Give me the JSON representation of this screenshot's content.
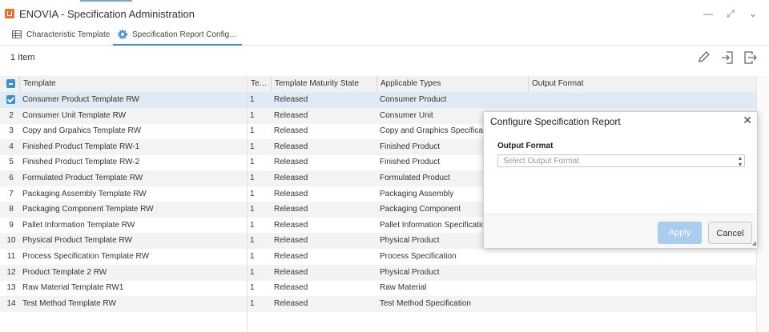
{
  "window": {
    "title": "ENOVIA - Specification Administration",
    "controls": {
      "minimize": "—",
      "expand": "⤢",
      "menu": "⌄"
    }
  },
  "tabs": [
    {
      "label": "Characteristic Template",
      "icon": "table-icon",
      "active": false
    },
    {
      "label": "Specification Report Config…",
      "icon": "gear-icon",
      "active": true
    }
  ],
  "toolbar": {
    "item_count": "1 Item",
    "icons": [
      "edit-icon",
      "import-icon",
      "export-icon"
    ]
  },
  "table": {
    "columns": [
      "Template",
      "Te…",
      "Template Maturity State",
      "Applicable Types",
      "Output Format"
    ],
    "rows": [
      {
        "num": "",
        "template": "Consumer Product Template RW",
        "rev": "1",
        "state": "Released",
        "type": "Consumer Product",
        "output": "",
        "selected": true
      },
      {
        "num": "2",
        "template": "Consumer Unit Template RW",
        "rev": "1",
        "state": "Released",
        "type": "Consumer Unit",
        "output": ""
      },
      {
        "num": "3",
        "template": "Copy and Grpahics Template RW",
        "rev": "1",
        "state": "Released",
        "type": "Copy and Graphics Specification",
        "output": ""
      },
      {
        "num": "4",
        "template": "Finished Product Template RW-1",
        "rev": "1",
        "state": "Released",
        "type": "Finished Product",
        "output": ""
      },
      {
        "num": "5",
        "template": "Finished Product Template RW-2",
        "rev": "1",
        "state": "Released",
        "type": "Finished Product",
        "output": ""
      },
      {
        "num": "6",
        "template": "Formulated Product Template RW",
        "rev": "1",
        "state": "Released",
        "type": "Formulated Product",
        "output": ""
      },
      {
        "num": "7",
        "template": "Packaging Assembly Template RW",
        "rev": "1",
        "state": "Released",
        "type": "Packaging Assembly",
        "output": ""
      },
      {
        "num": "8",
        "template": "Packaging Component Template RW",
        "rev": "1",
        "state": "Released",
        "type": "Packaging Component",
        "output": ""
      },
      {
        "num": "9",
        "template": "Pallet Information Template RW",
        "rev": "1",
        "state": "Released",
        "type": "Pallet Information Specification",
        "output": ""
      },
      {
        "num": "10",
        "template": "Physical Product Template RW",
        "rev": "1",
        "state": "Released",
        "type": "Physical Product",
        "output": ""
      },
      {
        "num": "11",
        "template": "Process Specification Template RW",
        "rev": "1",
        "state": "Released",
        "type": "Process Specification",
        "output": ""
      },
      {
        "num": "12",
        "template": "Product Template 2 RW",
        "rev": "1",
        "state": "Released",
        "type": "Physical Product",
        "output": ""
      },
      {
        "num": "13",
        "template": "Raw Material Template RW1",
        "rev": "1",
        "state": "Released",
        "type": "Raw Material",
        "output": ""
      },
      {
        "num": "14",
        "template": "Test Method Template RW",
        "rev": "1",
        "state": "Released",
        "type": "Test Method Specification",
        "output": ""
      }
    ]
  },
  "dialog": {
    "title": "Configure Specification Report",
    "close": "✕",
    "field_label": "Output Format",
    "select_placeholder": "Select Output Format",
    "apply_label": "Apply",
    "cancel_label": "Cancel"
  },
  "colors": {
    "accent": "#3d8fd6",
    "apply_disabled": "#a9cdee",
    "app_icon": "#e8732d",
    "selected_row": "#dfeaf4"
  }
}
